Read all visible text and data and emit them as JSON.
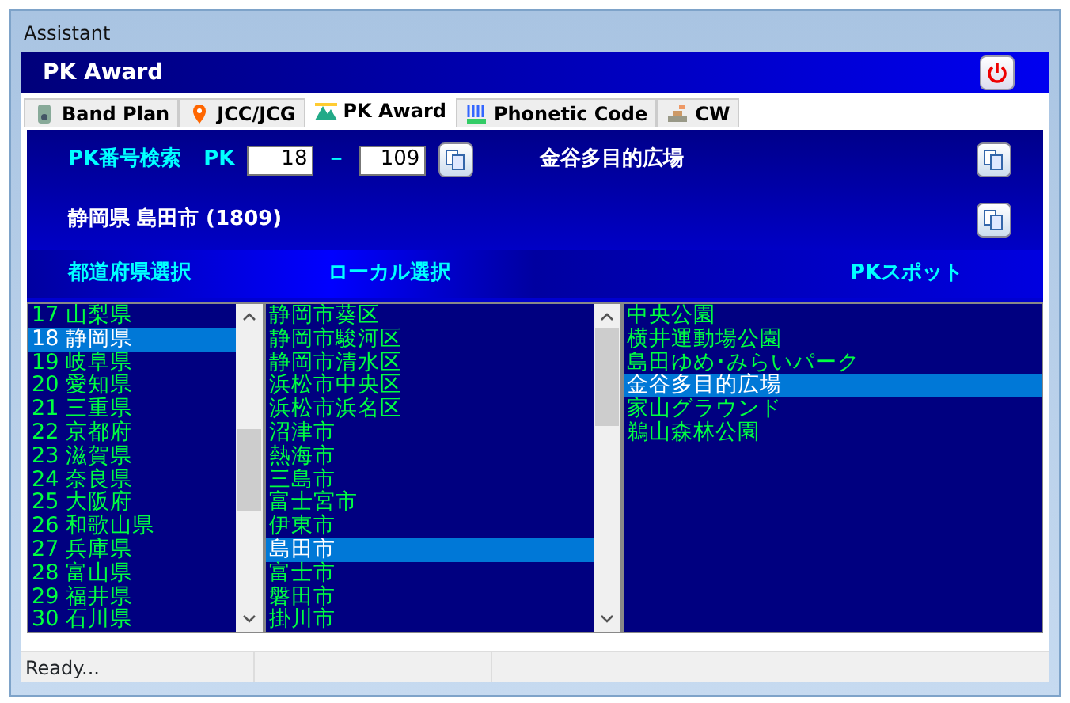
{
  "window": {
    "title": "Assistant"
  },
  "header": {
    "title": "PK Award"
  },
  "tabs": [
    {
      "label": "Band Plan",
      "kind": "radio",
      "selected": false
    },
    {
      "label": "JCC/JCG",
      "kind": "pin",
      "selected": false
    },
    {
      "label": "PK Award",
      "kind": "mountain",
      "selected": true
    },
    {
      "label": "Phonetic Code",
      "kind": "bars",
      "selected": false
    },
    {
      "label": "CW",
      "kind": "key",
      "selected": false
    }
  ],
  "search": {
    "label": "PK番号検索",
    "prefix": "PK",
    "from": "18",
    "separator": "－",
    "to": "109",
    "result": "金谷多目的広場"
  },
  "location": "静岡県 島田市 (1809)",
  "columns": [
    "都道府県選択",
    "ローカル選択",
    "PKスポット"
  ],
  "prefectures": [
    {
      "label": "17 山梨県",
      "selected": false
    },
    {
      "label": "18 静岡県",
      "selected": true
    },
    {
      "label": "19 岐阜県",
      "selected": false
    },
    {
      "label": "20 愛知県",
      "selected": false
    },
    {
      "label": "21 三重県",
      "selected": false
    },
    {
      "label": "22 京都府",
      "selected": false
    },
    {
      "label": "23 滋賀県",
      "selected": false
    },
    {
      "label": "24 奈良県",
      "selected": false
    },
    {
      "label": "25 大阪府",
      "selected": false
    },
    {
      "label": "26 和歌山県",
      "selected": false
    },
    {
      "label": "27 兵庫県",
      "selected": false
    },
    {
      "label": "28 富山県",
      "selected": false
    },
    {
      "label": "29 福井県",
      "selected": false
    },
    {
      "label": "30 石川県",
      "selected": false
    }
  ],
  "locals": [
    {
      "label": "静岡市葵区",
      "selected": false
    },
    {
      "label": "静岡市駿河区",
      "selected": false
    },
    {
      "label": "静岡市清水区",
      "selected": false
    },
    {
      "label": "浜松市中央区",
      "selected": false
    },
    {
      "label": "浜松市浜名区",
      "selected": false
    },
    {
      "label": "沼津市",
      "selected": false
    },
    {
      "label": "熱海市",
      "selected": false
    },
    {
      "label": "三島市",
      "selected": false
    },
    {
      "label": "富士宮市",
      "selected": false
    },
    {
      "label": "伊東市",
      "selected": false
    },
    {
      "label": "島田市",
      "selected": true
    },
    {
      "label": "富士市",
      "selected": false
    },
    {
      "label": "磐田市",
      "selected": false
    },
    {
      "label": "掛川市",
      "selected": false
    }
  ],
  "spots": [
    {
      "label": "中央公園",
      "selected": false
    },
    {
      "label": "横井運動場公園",
      "selected": false
    },
    {
      "label": "島田ゆめ･みらいパーク",
      "selected": false
    },
    {
      "label": "金谷多目的広場",
      "selected": true
    },
    {
      "label": "家山グラウンド",
      "selected": false
    },
    {
      "label": "鵜山森林公園",
      "selected": false
    }
  ],
  "status_bar": {
    "text": "Ready..."
  }
}
